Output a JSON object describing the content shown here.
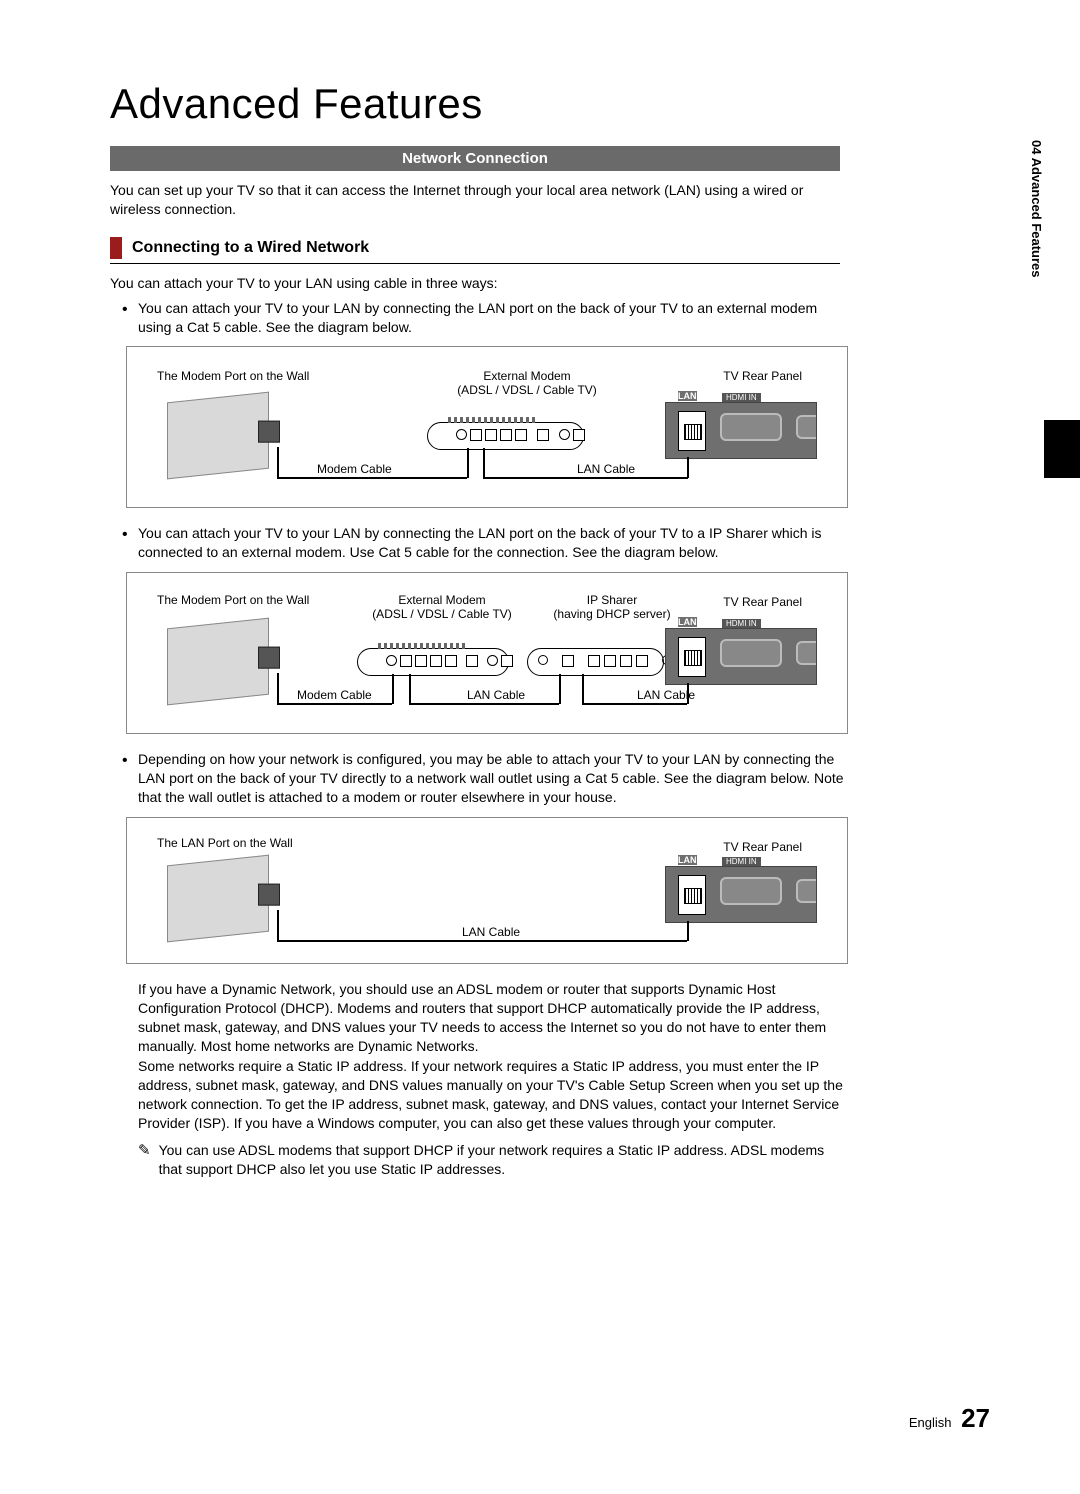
{
  "page_title": "Advanced Features",
  "section_header": "Network Connection",
  "intro_text": "You can set up your TV so that it can access the Internet through your local area network (LAN) using a wired or wireless connection.",
  "subheading": "Connecting to a Wired Network",
  "lead_text": "You can attach your TV to your LAN using cable in three ways:",
  "bullet1": "You can attach your TV to your LAN by connecting the LAN port on the back of your TV to an external modem using a Cat 5 cable. See the diagram below.",
  "bullet2": "You can attach your TV to your LAN by connecting the LAN port on the back of your TV to a IP Sharer which is connected to an external modem. Use Cat 5 cable for the connection. See the diagram below.",
  "bullet3": "Depending on how your network is configured, you may be able to attach your TV to your LAN by connecting the LAN port on the back of your TV directly to a network wall outlet using a Cat 5 cable. See the diagram below. Note that the wall outlet is attached to a modem or router elsewhere in your house.",
  "diagram1": {
    "wall_label": "The Modem Port on the Wall",
    "modem_label_1": "External Modem",
    "modem_label_2": "(ADSL / VDSL / Cable TV)",
    "tv_label": "TV Rear Panel",
    "cable1": "Modem Cable",
    "cable2": "LAN Cable",
    "lan": "LAN",
    "hdmi": "HDMI IN"
  },
  "diagram2": {
    "wall_label": "The Modem Port on the Wall",
    "modem_label_1": "External Modem",
    "modem_label_2": "(ADSL / VDSL / Cable TV)",
    "sharer_label_1": "IP Sharer",
    "sharer_label_2": "(having DHCP server)",
    "tv_label": "TV Rear Panel",
    "cable1": "Modem Cable",
    "cable2": "LAN Cable",
    "cable3": "LAN Cable",
    "lan": "LAN",
    "hdmi": "HDMI IN"
  },
  "diagram3": {
    "wall_label": "The LAN Port on the Wall",
    "tv_label": "TV Rear Panel",
    "cable1": "LAN Cable",
    "lan": "LAN",
    "hdmi": "HDMI IN"
  },
  "para_dhcp": "If you have a Dynamic Network, you should use an ADSL modem or router that supports Dynamic Host Configuration Protocol (DHCP). Modems and routers that support DHCP automatically provide the IP address, subnet mask, gateway, and DNS values your TV needs to access the Internet so you do not have to enter them manually. Most home networks are Dynamic Networks.",
  "para_static": "Some networks require a Static IP address. If your network requires a Static IP address, you must enter the IP address, subnet mask, gateway, and DNS values manually on your TV's Cable Setup Screen when you set up the network connection. To get the IP address, subnet mask, gateway, and DNS values, contact your Internet Service Provider (ISP). If you have a Windows computer, you can also get these values through your computer.",
  "note_text": "You can use ADSL modems that support DHCP if your network requires a Static IP address. ADSL modems that support DHCP also let you use Static IP addresses.",
  "side_tab": "04   Advanced Features",
  "footer_lang": "English",
  "footer_page": "27"
}
